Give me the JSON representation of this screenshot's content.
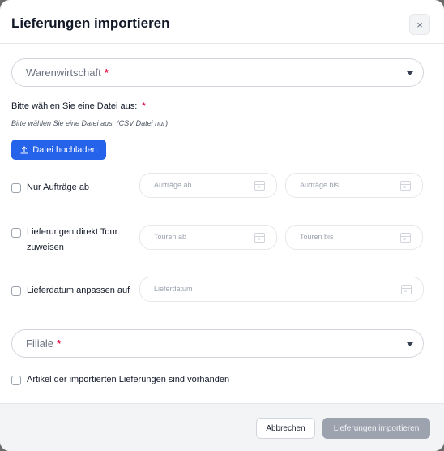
{
  "dialog": {
    "title": "Lieferungen importieren",
    "close_symbol": "×"
  },
  "warenwirtschaft": {
    "placeholder": "Warenwirtschaft",
    "required_mark": "*"
  },
  "file": {
    "label": "Bitte wählen Sie eine Datei aus:",
    "required_mark": "*",
    "hint": "Bitte wählen Sie eine Datei aus: (CSV Datei nur)",
    "upload_label": "Datei hochladen"
  },
  "options": {
    "nur_auftraege": {
      "label": "Nur Aufträge ab",
      "checked": false,
      "from_placeholder": "Aufträge ab",
      "to_placeholder": "Aufträge bis"
    },
    "tour_zuweisen": {
      "label_line1": "Lieferungen direkt Tour",
      "label_line2": "zuweisen",
      "checked": false,
      "from_placeholder": "Touren ab",
      "to_placeholder": "Touren bis"
    },
    "lieferdatum": {
      "label": "Lieferdatum anpassen auf",
      "checked": false,
      "placeholder": "Lieferdatum"
    }
  },
  "filiale": {
    "placeholder": "Filiale",
    "required_mark": "*"
  },
  "artikel_vorhanden": {
    "label": "Artikel der importierten Lieferungen sind vorhanden",
    "checked": false
  },
  "footer": {
    "cancel_label": "Abbrechen",
    "import_label": "Lieferungen importieren"
  },
  "colors": {
    "primary": "#2563eb",
    "required": "#e11d48",
    "disabled_button": "#9ca3af"
  }
}
